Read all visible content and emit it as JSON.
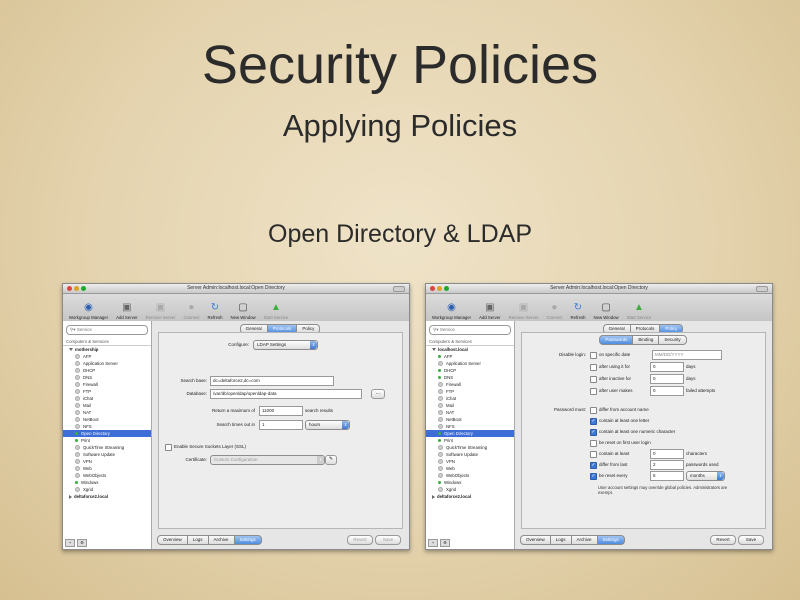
{
  "slide": {
    "title": "Security Policies",
    "subtitle": "Applying Policies",
    "section": "Open Directory & LDAP"
  },
  "window1": {
    "title": "Server Admin:localhost.local:Open Directory",
    "toolbar": [
      "Workgroup Manager",
      "Add Server",
      "Remove Server",
      "Connect",
      "Refresh",
      "New Window",
      "Start Service"
    ],
    "search_placeholder": "Service",
    "tree_header": "Computers & Services",
    "server1": "mothership",
    "services": [
      {
        "name": "AFP",
        "on": false
      },
      {
        "name": "Application Server",
        "on": false
      },
      {
        "name": "DHCP",
        "on": false
      },
      {
        "name": "DNS",
        "on": false
      },
      {
        "name": "Firewall",
        "on": false
      },
      {
        "name": "FTP",
        "on": false
      },
      {
        "name": "iChat",
        "on": false
      },
      {
        "name": "Mail",
        "on": false
      },
      {
        "name": "NAT",
        "on": false
      },
      {
        "name": "NetBoot",
        "on": false
      },
      {
        "name": "NFS",
        "on": false
      },
      {
        "name": "Open Directory",
        "on": true
      },
      {
        "name": "Print",
        "on": true
      },
      {
        "name": "QuickTime Streaming",
        "on": false
      },
      {
        "name": "Software Update",
        "on": false
      },
      {
        "name": "VPN",
        "on": false
      },
      {
        "name": "Web",
        "on": false
      },
      {
        "name": "WebObjects",
        "on": false
      },
      {
        "name": "Windows",
        "on": true
      },
      {
        "name": "Xgrid",
        "on": false
      }
    ],
    "server2": "deltaforce2.local",
    "tabs": [
      "General",
      "Protocols",
      "Policy"
    ],
    "active_tab": 1,
    "configure_label": "Configure:",
    "configure_value": "LDAP Settings",
    "search_base_label": "Search base:",
    "search_base_value": "dc=deltaforce2,dc=com",
    "database_label": "Database:",
    "database_value": "/var/db/openldap/openldap-data",
    "browse": "...",
    "return_max_label": "Return a maximum of",
    "return_max_value": "11000",
    "return_max_unit": "search results",
    "search_time_label": "Search times out in",
    "search_time_value": "1",
    "search_time_unit": "hours",
    "ssl_label": "Enable Secure Sockets Layer (SSL)",
    "cert_label": "Certificate:",
    "cert_value": "Custom Configuration",
    "bottom_tabs": [
      "Overview",
      "Logs",
      "Archive",
      "Settings"
    ],
    "bottom_active": 3,
    "revert": "Revert",
    "save": "Save"
  },
  "window2": {
    "title": "Server Admin:localhost.local:Open Directory",
    "toolbar": [
      "Workgroup Manager",
      "Add Server",
      "Remove Server",
      "Connect",
      "Refresh",
      "New Window",
      "Start Service"
    ],
    "search_placeholder": "Service",
    "tree_header": "Computers & Services",
    "server1": "localhost.local",
    "services": [
      {
        "name": "AFP",
        "on": true
      },
      {
        "name": "Application Server",
        "on": false
      },
      {
        "name": "DHCP",
        "on": true
      },
      {
        "name": "DNS",
        "on": true
      },
      {
        "name": "Firewall",
        "on": false
      },
      {
        "name": "FTP",
        "on": false
      },
      {
        "name": "iChat",
        "on": false
      },
      {
        "name": "Mail",
        "on": false
      },
      {
        "name": "NAT",
        "on": false
      },
      {
        "name": "NetBoot",
        "on": false
      },
      {
        "name": "NFS",
        "on": false
      },
      {
        "name": "Open Directory",
        "on": true
      },
      {
        "name": "Print",
        "on": true
      },
      {
        "name": "QuickTime Streaming",
        "on": false
      },
      {
        "name": "Software Update",
        "on": false
      },
      {
        "name": "VPN",
        "on": false
      },
      {
        "name": "Web",
        "on": false
      },
      {
        "name": "WebObjects",
        "on": false
      },
      {
        "name": "Windows",
        "on": true
      },
      {
        "name": "Xgrid",
        "on": false
      }
    ],
    "server2": "deltaforce2.local",
    "tabs": [
      "General",
      "Protocols",
      "Policy"
    ],
    "active_tab": 2,
    "subtabs": [
      "Passwords",
      "Binding",
      "Security"
    ],
    "active_subtab": 0,
    "disable_label": "Disable login:",
    "disable_rows": [
      {
        "on": false,
        "text": "on specific date",
        "value": "MM/DD/YYYY",
        "unit": ""
      },
      {
        "on": false,
        "text": "after using it for",
        "value": "0",
        "unit": "days"
      },
      {
        "on": false,
        "text": "after inactive for",
        "value": "0",
        "unit": "days"
      },
      {
        "on": false,
        "text": "after user makes",
        "value": "0",
        "unit": "failed attempts"
      }
    ],
    "password_label": "Password must:",
    "password_rows": [
      {
        "on": false,
        "text": "differ from account name",
        "value": "",
        "unit": ""
      },
      {
        "on": true,
        "text": "contain at least one letter",
        "value": "",
        "unit": ""
      },
      {
        "on": true,
        "text": "contain at least one numeric character",
        "value": "",
        "unit": ""
      },
      {
        "on": false,
        "text": "be reset on first user login",
        "value": "",
        "unit": ""
      },
      {
        "on": false,
        "text": "contain at least",
        "value": "0",
        "unit": "characters"
      },
      {
        "on": true,
        "text": "differ from last",
        "value": "2",
        "unit": "passwords used"
      },
      {
        "on": true,
        "text": "be reset every",
        "value": "6",
        "unit": "months"
      }
    ],
    "note": "User account settings may override global policies. Administrators are exempt.",
    "bottom_tabs": [
      "Overview",
      "Logs",
      "Archive",
      "Settings"
    ],
    "bottom_active": 3,
    "revert": "Revert",
    "save": "Save"
  }
}
